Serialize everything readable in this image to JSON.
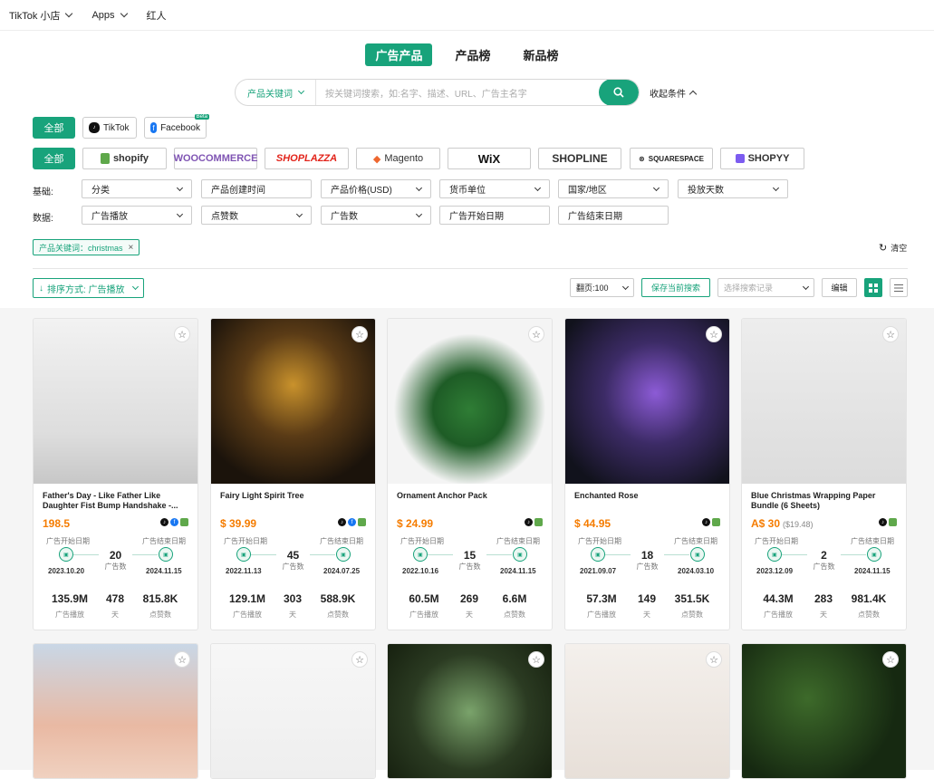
{
  "topbar": {
    "items": [
      "TikTok 小店",
      "Apps",
      "红人"
    ]
  },
  "tabs": [
    {
      "label": "广告产品",
      "active": true
    },
    {
      "label": "产品榜"
    },
    {
      "label": "新品榜"
    }
  ],
  "search": {
    "select_label": "产品关键词",
    "placeholder": "按关键词搜索，如:名字、描述、URL、广告主名字",
    "collapse_label": "收起条件"
  },
  "platform_row": {
    "all_label": "全部",
    "chips": [
      "TikTok",
      "Facebook"
    ],
    "beta_label": "Beta"
  },
  "store_row": {
    "all_label": "全部",
    "stores": [
      "shopify",
      "WOOCOMMERCE",
      "SHOPLAZZA",
      "Magento",
      "WiX",
      "SHOPLINE",
      "SQUARESPACE",
      "SHOPYY"
    ]
  },
  "filters": {
    "basic_label": "基础:",
    "basic": [
      "分类",
      "产品创建时间",
      "产品价格(USD)",
      "货币单位",
      "国家/地区",
      "投放天数"
    ],
    "data_label": "数据:",
    "data": [
      "广告播放",
      "点赞数",
      "广告数",
      "广告开始日期",
      "广告结束日期"
    ]
  },
  "active_tag": {
    "label": "产品关键词：christmas"
  },
  "clear_label": "清空",
  "toolbar": {
    "sort_label": "排序方式: 广告播放",
    "page_size": "翻页:100",
    "save_label": "保存当前搜索",
    "history_placeholder": "选择搜索记录",
    "edit_label": "编辑"
  },
  "card_labels": {
    "start": "广告开始日期",
    "end": "广告结束日期",
    "ads": "广告数",
    "plays": "广告播放",
    "days": "天",
    "likes": "点赞数"
  },
  "products": [
    {
      "title": "Father's Day - Like Father Like Daughter Fist Bump Handshake -...",
      "price": "198.5",
      "price_sub": "",
      "start": "2023.10.20",
      "end": "2024.11.15",
      "ads": "20",
      "plays": "135.9M",
      "days": "478",
      "likes": "815.8K",
      "platforms": [
        "tt",
        "fb",
        "sh"
      ]
    },
    {
      "title": "Fairy Light Spirit Tree",
      "price": "$ 39.99",
      "price_sub": "",
      "start": "2022.11.13",
      "end": "2024.07.25",
      "ads": "45",
      "plays": "129.1M",
      "days": "303",
      "likes": "588.9K",
      "platforms": [
        "tt",
        "fb",
        "sh"
      ]
    },
    {
      "title": "Ornament Anchor Pack",
      "price": "$ 24.99",
      "price_sub": "",
      "start": "2022.10.16",
      "end": "2024.11.15",
      "ads": "15",
      "plays": "60.5M",
      "days": "269",
      "likes": "6.6M",
      "platforms": [
        "tt",
        "sh"
      ]
    },
    {
      "title": "Enchanted Rose",
      "price": "$ 44.95",
      "price_sub": "",
      "start": "2021.09.07",
      "end": "2024.03.10",
      "ads": "18",
      "plays": "57.3M",
      "days": "149",
      "likes": "351.5K",
      "platforms": [
        "tt",
        "sh"
      ]
    },
    {
      "title": "Blue Christmas Wrapping Paper Bundle (6 Sheets)",
      "price": "A$ 30",
      "price_sub": "($19.48)",
      "start": "2023.12.09",
      "end": "2024.11.15",
      "ads": "2",
      "plays": "44.3M",
      "days": "283",
      "likes": "981.4K",
      "platforms": [
        "tt",
        "sh"
      ]
    }
  ],
  "colors": {
    "accent": "#18a37b",
    "price": "#f57c00"
  }
}
